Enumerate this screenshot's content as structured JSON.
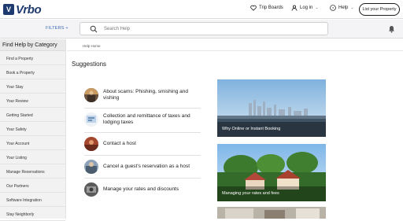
{
  "header": {
    "logo_text": "Vrbo",
    "trip_boards": "Trip Boards",
    "login": "Log in",
    "help": "Help",
    "list_property": "List your Property"
  },
  "searchbar": {
    "filters": "FILTERS +",
    "placeholder": "Search Help"
  },
  "sidebar": {
    "title": "Find Help by Category",
    "items": [
      {
        "label": "Find a Property"
      },
      {
        "label": "Book a Property"
      },
      {
        "label": "Your Stay"
      },
      {
        "label": "Your Review"
      },
      {
        "label": "Getting Started"
      },
      {
        "label": "Your Safety"
      },
      {
        "label": "Your Account"
      },
      {
        "label": "Your Listing"
      },
      {
        "label": "Manage Reservations"
      },
      {
        "label": "Our Partners"
      },
      {
        "label": "Software Integration"
      },
      {
        "label": "Stay Neighborly"
      }
    ]
  },
  "main": {
    "breadcrumb": "Help Home",
    "section_title": "Suggestions",
    "suggestions": [
      {
        "label": "About scams: Phishing, smishing and vishing"
      },
      {
        "label": "Collection and remittance of taxes and lodging taxes"
      },
      {
        "label": "Contact a host"
      },
      {
        "label": "Cancel a guest's reservation as a host"
      },
      {
        "label": "Manage your rates and discounts"
      }
    ],
    "cards": [
      {
        "label": "Why Online or Instant Booking"
      },
      {
        "label": "Managing your rates and fees"
      }
    ]
  },
  "colors": {
    "brand": "#1e3a6e",
    "link": "#3a68b8"
  }
}
